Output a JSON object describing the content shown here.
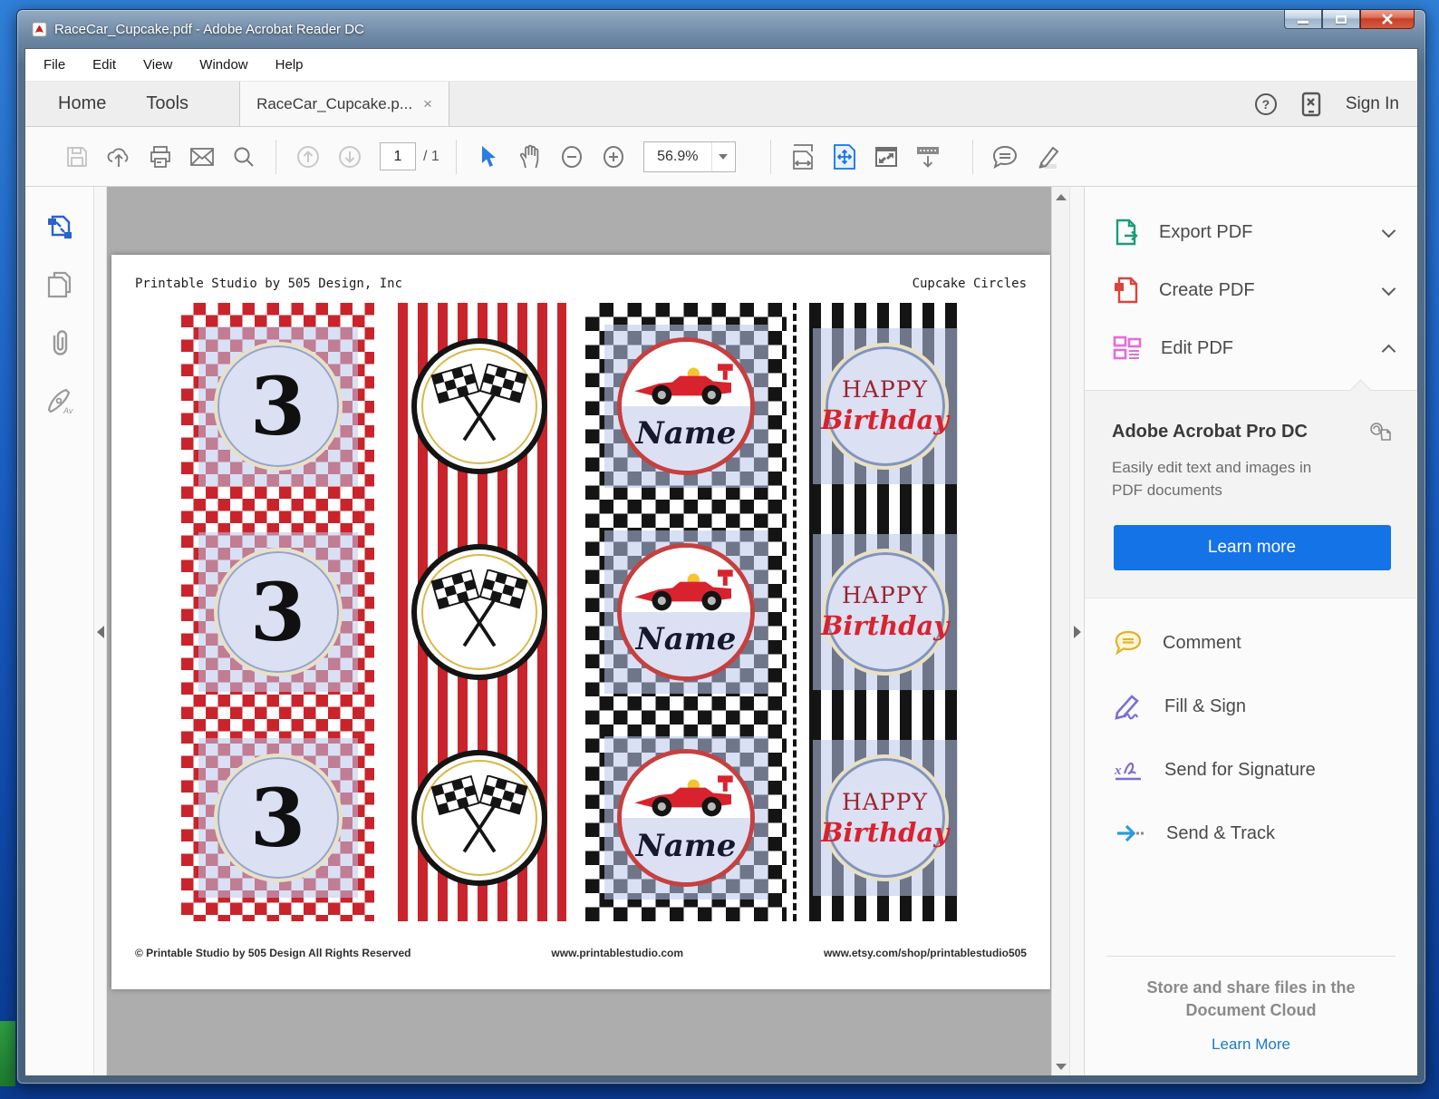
{
  "window": {
    "title": "RaceCar_Cupcake.pdf - Adobe Acrobat Reader DC"
  },
  "menu_bar": {
    "items": [
      "File",
      "Edit",
      "View",
      "Window",
      "Help"
    ]
  },
  "tab_bar": {
    "home": "Home",
    "tools": "Tools",
    "document_tab": "RaceCar_Cupcake.p...",
    "close_glyph": "×",
    "help_glyph": "?",
    "sign_in": "Sign In"
  },
  "toolbar": {
    "page_current": "1",
    "page_total": "/ 1",
    "zoom_value": "56.9%"
  },
  "pdf": {
    "header_left": "Printable Studio by 505 Design, Inc",
    "header_right": "Cupcake Circles",
    "topper_number": "3",
    "topper_name": "Name",
    "topper_happy": "HAPPY",
    "topper_birthday": "Birthday",
    "footer_left": "© Printable Studio by 505 Design All Rights Reserved",
    "footer_center": "www.printablestudio.com",
    "footer_right": "www.etsy.com/shop/printablestudio505"
  },
  "right_panel": {
    "tools": [
      {
        "label": "Export PDF"
      },
      {
        "label": "Create PDF"
      },
      {
        "label": "Edit PDF"
      }
    ],
    "promo": {
      "title": "Adobe Acrobat Pro DC",
      "line1": "Easily edit text and images in",
      "line2": "PDF documents",
      "button": "Learn more"
    },
    "actions": [
      {
        "label": "Comment"
      },
      {
        "label": "Fill & Sign"
      },
      {
        "label": "Send for Signature"
      },
      {
        "label": "Send & Track"
      }
    ],
    "cloud": {
      "line1": "Store and share files in the",
      "line2": "Document Cloud",
      "link": "Learn More"
    }
  },
  "colors": {
    "accent_blue": "#1473e6",
    "checker_red": "#c9242b",
    "stripe_black": "#141414",
    "circle_lavender": "#dbe0f3",
    "link_blue": "#1a7bc4"
  }
}
